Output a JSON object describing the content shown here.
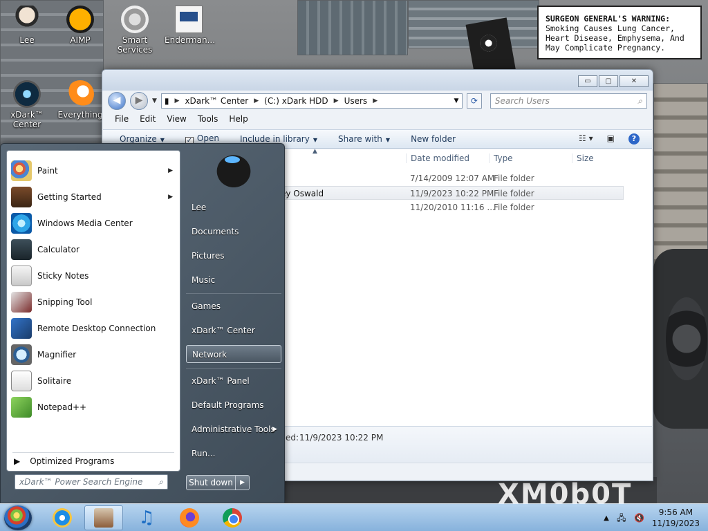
{
  "desktop": {
    "icons": [
      {
        "label": "Lee"
      },
      {
        "label": "AIMP"
      },
      {
        "label": "Smart Services"
      },
      {
        "label": "Enderman..."
      },
      {
        "label": "xDark™ Center"
      },
      {
        "label": "Everything"
      }
    ],
    "warning": {
      "bold": "SURGEON GENERAL'S WARNING:",
      "text": "Smoking Causes Lung Cancer, Heart Disease, Emphysema, And May Complicate Pregnancy."
    },
    "wallpaper_text": "XM0b0T"
  },
  "explorer": {
    "window_buttons": {
      "minimize": "▭",
      "maximize": "▢",
      "close": "✕"
    },
    "address": {
      "crumbs": [
        "xDark™ Center",
        "(C:) xDark HDD",
        "Users"
      ]
    },
    "search": {
      "placeholder": "Search Users"
    },
    "menu": [
      "File",
      "Edit",
      "View",
      "Tools",
      "Help"
    ],
    "commands": {
      "organize": "Organize",
      "open": "Open",
      "include": "Include in library",
      "share": "Share with",
      "new_folder": "New folder"
    },
    "columns": {
      "date": "Date modified",
      "type": "Type",
      "size": "Size"
    },
    "rows": [
      {
        "name": "",
        "date": "7/14/2009 12:07 AM",
        "type": "File folder"
      },
      {
        "name": "ey Oswald",
        "date": "11/9/2023 10:22 PM",
        "type": "File folder"
      },
      {
        "name": "",
        "date": "11/20/2010 11:16 ...",
        "type": "File folder"
      }
    ],
    "details": {
      "label": "ed:",
      "value": "11/9/2023 10:22 PM"
    }
  },
  "startmenu": {
    "programs": [
      {
        "label": "Paint",
        "arrow": "▶"
      },
      {
        "label": "Getting Started",
        "arrow": "▶"
      },
      {
        "label": "Windows Media Center",
        "arrow": ""
      },
      {
        "label": "Calculator",
        "arrow": ""
      },
      {
        "label": "Sticky Notes",
        "arrow": ""
      },
      {
        "label": "Snipping Tool",
        "arrow": ""
      },
      {
        "label": "Remote Desktop Connection",
        "arrow": ""
      },
      {
        "label": "Magnifier",
        "arrow": ""
      },
      {
        "label": "Solitaire",
        "arrow": ""
      },
      {
        "label": "Notepad++",
        "arrow": ""
      }
    ],
    "optimized": "Optimized Programs",
    "search_placeholder": "xDark™ Power Search Engine",
    "right_links": [
      {
        "label": "Lee",
        "arrow": ""
      },
      {
        "label": "Documents",
        "arrow": ""
      },
      {
        "label": "Pictures",
        "arrow": ""
      },
      {
        "label": "Music",
        "arrow": ""
      },
      {
        "label": "Games",
        "arrow": ""
      },
      {
        "label": "xDark™ Center",
        "arrow": ""
      },
      {
        "label": "Network",
        "arrow": ""
      },
      {
        "label": "xDark™ Panel",
        "arrow": ""
      },
      {
        "label": "Default Programs",
        "arrow": ""
      },
      {
        "label": "Administrative Tools",
        "arrow": "▶"
      },
      {
        "label": "Run...",
        "arrow": ""
      }
    ],
    "shutdown": "Shut down"
  },
  "taskbar": {
    "time": "9:56 AM",
    "date": "11/19/2023"
  }
}
